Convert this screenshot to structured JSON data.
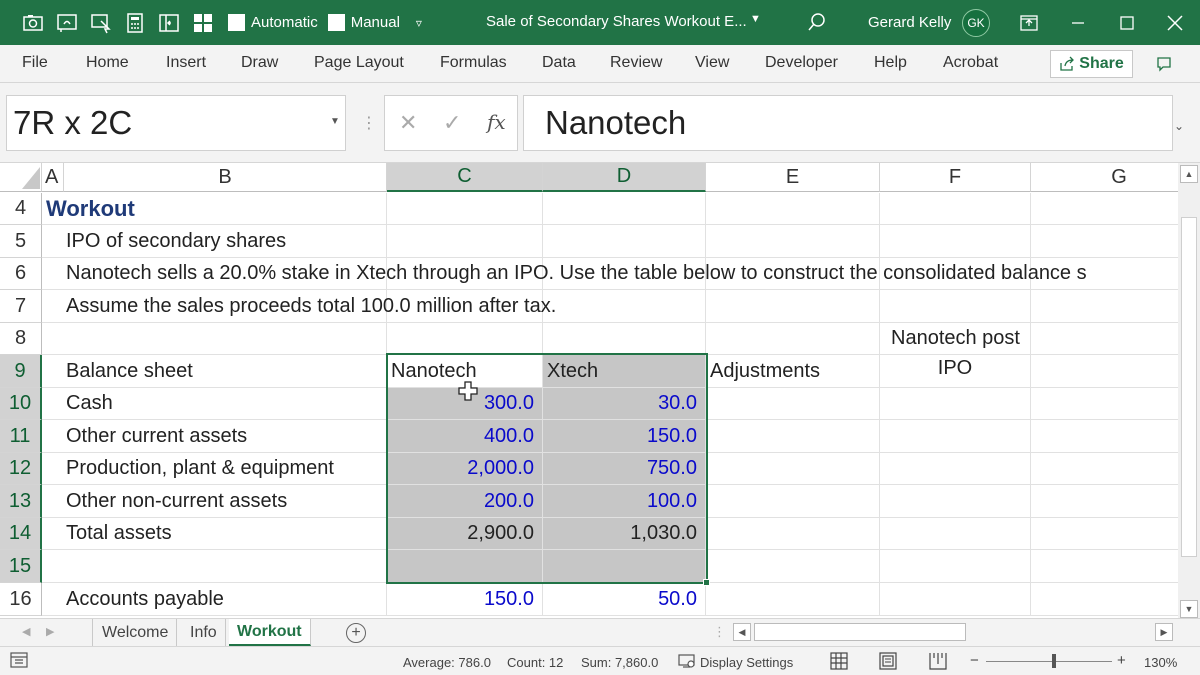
{
  "titlebar": {
    "autosave_label": "Automatic",
    "manual_label": "Manual",
    "doc_title": "Sale of Secondary Shares Workout E...",
    "user_name": "Gerard Kelly",
    "user_initials": "GK",
    "bg_color": "#217346"
  },
  "ribbon": {
    "tabs": [
      "File",
      "Home",
      "Insert",
      "Draw",
      "Page Layout",
      "Formulas",
      "Data",
      "Review",
      "View",
      "Developer",
      "Help",
      "Acrobat"
    ],
    "share_label": "Share"
  },
  "formula_bar": {
    "name_box": "7R x 2C",
    "fx_label": "fx",
    "content": "Nanotech"
  },
  "grid": {
    "columns": [
      "A",
      "B",
      "C",
      "D",
      "E",
      "F",
      "G"
    ],
    "rows": [
      "4",
      "5",
      "6",
      "7",
      "8",
      "9",
      "10",
      "11",
      "12",
      "13",
      "14",
      "15",
      "16"
    ],
    "cells": {
      "r4_title": "Workout",
      "r5_text": "IPO of secondary shares",
      "r6_text": "Nanotech sells a 20.0% stake in Xtech through an IPO. Use the table below to construct the consolidated balance s",
      "r7_text": "Assume the sales proceeds total 100.0 million after tax.",
      "f8_text": "Nanotech post",
      "b9": "Balance sheet",
      "c9": "Nanotech",
      "d9": "Xtech",
      "e9": "Adjustments",
      "f9_text": "IPO",
      "b10": "Cash",
      "c10": "300.0",
      "d10": "30.0",
      "b11": "Other current assets",
      "c11": "400.0",
      "d11": "150.0",
      "b12": "Production, plant & equipment",
      "c12": "2,000.0",
      "d12": "750.0",
      "b13": "Other non-current assets",
      "c13": "200.0",
      "d13": "100.0",
      "b14": "Total assets",
      "c14": "2,900.0",
      "d14": "1,030.0",
      "b16": "Accounts payable",
      "c16": "150.0",
      "d16": "50.0"
    },
    "input_color": "#0a0acb",
    "title_color": "#1f3a78"
  },
  "sheets": {
    "tabs": [
      "Welcome",
      "Info",
      "Workout"
    ],
    "active": "Workout"
  },
  "statusbar": {
    "average": "Average: 786.0",
    "count": "Count: 12",
    "sum": "Sum: 7,860.0",
    "display_settings": "Display Settings",
    "zoom": "130%",
    "zoom_minus": "−",
    "zoom_plus": "+"
  }
}
